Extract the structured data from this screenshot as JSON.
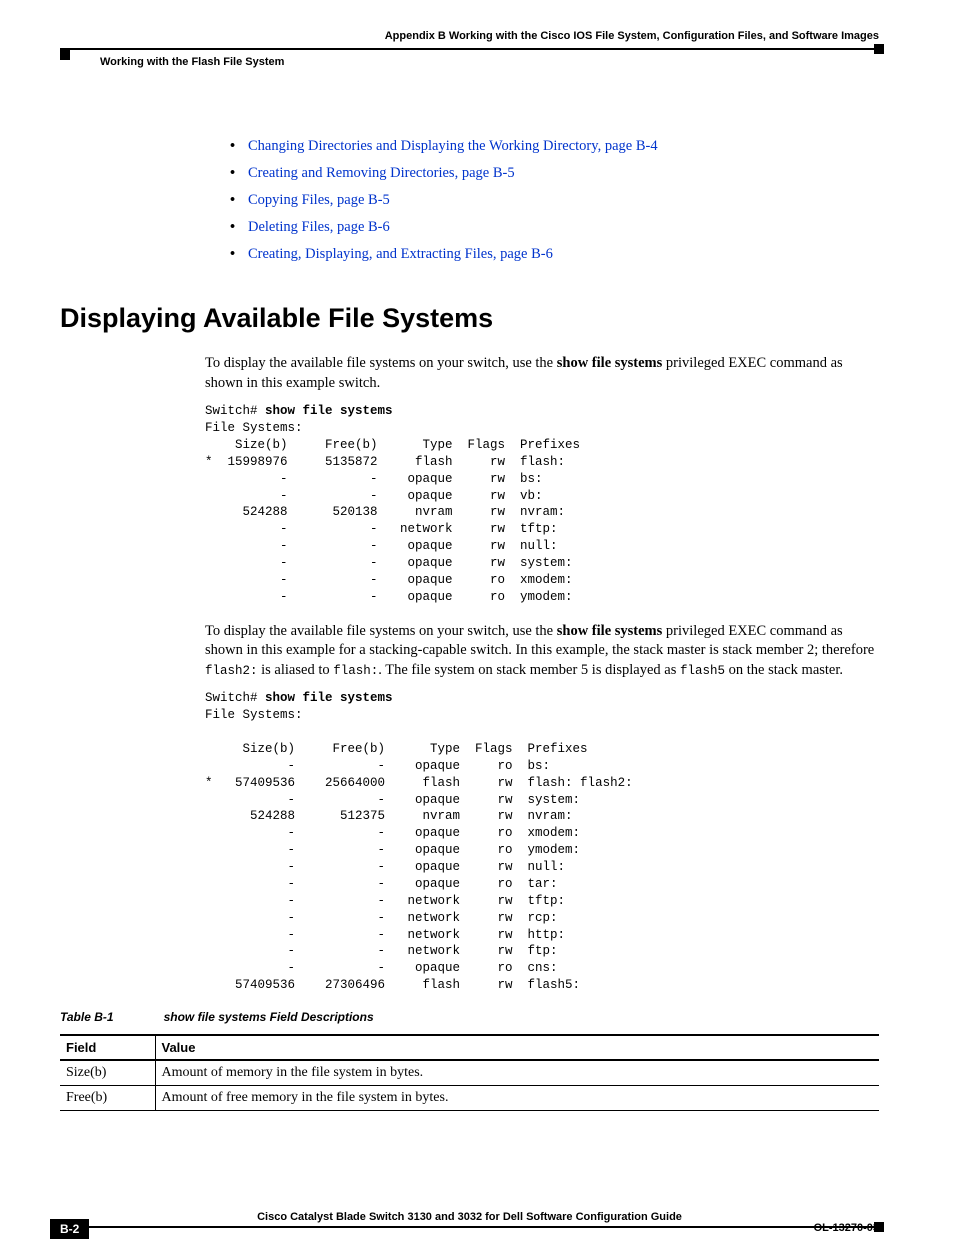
{
  "header": {
    "appendix": "Appendix B      Working with the Cisco IOS File System, Configuration Files, and Software Images",
    "section": "Working with the Flash File System"
  },
  "links": {
    "l1": "Changing Directories and Displaying the Working Directory, page B-4",
    "l2": "Creating and Removing Directories, page B-5",
    "l3": "Copying Files, page B-5",
    "l4": "Deleting Files, page B-6",
    "l5": "Creating, Displaying, and Extracting Files, page B-6"
  },
  "heading": "Displaying Available File Systems",
  "para1_a": "To display the available file systems on your switch, use the ",
  "para1_b": "show file systems",
  "para1_c": " privileged EXEC command as shown in this example switch.",
  "code1_prefix": "Switch# ",
  "code1_cmd": "show file systems",
  "code1_body": "File Systems:\n    Size(b)     Free(b)      Type  Flags  Prefixes\n*  15998976     5135872     flash     rw  flash:\n          -           -    opaque     rw  bs:\n          -           -    opaque     rw  vb:\n     524288      520138     nvram     rw  nvram:\n          -           -   network     rw  tftp:\n          -           -    opaque     rw  null:\n          -           -    opaque     rw  system:\n          -           -    opaque     ro  xmodem:\n          -           -    opaque     ro  ymodem:",
  "para2_a": "To display the available file systems on your switch, use the ",
  "para2_b": "show file systems",
  "para2_c": " privileged EXEC command as shown in this example for a stacking-capable switch. In this example, the stack master is stack member 2; therefore ",
  "para2_d": "flash2:",
  "para2_e": " is aliased to ",
  "para2_f": "flash:",
  "para2_g": ". The file system on stack member 5 is displayed as ",
  "para2_h": "flash5",
  "para2_i": " on the stack master.",
  "code2_prefix": "Switch# ",
  "code2_cmd": "show file systems",
  "code2_body": "File Systems:\n\n     Size(b)     Free(b)      Type  Flags  Prefixes\n           -           -    opaque     ro  bs:\n*   57409536    25664000     flash     rw  flash: flash2:\n           -           -    opaque     rw  system:\n      524288      512375     nvram     rw  nvram:\n           -           -    opaque     ro  xmodem:\n           -           -    opaque     ro  ymodem:\n           -           -    opaque     rw  null:\n           -           -    opaque     ro  tar:\n           -           -   network     rw  tftp:\n           -           -   network     rw  rcp:\n           -           -   network     rw  http:\n           -           -   network     rw  ftp:\n           -           -    opaque     ro  cns:\n    57409536    27306496     flash     rw  flash5:",
  "table": {
    "id": "Table B-1",
    "title": "show file systems Field Descriptions",
    "th_field": "Field",
    "th_value": "Value",
    "rows": [
      {
        "field": "Size(b)",
        "value": "Amount of memory in the file system in bytes."
      },
      {
        "field": "Free(b)",
        "value": "Amount of free memory in the file system in bytes."
      }
    ]
  },
  "footer": {
    "title": "Cisco Catalyst Blade Switch 3130 and 3032 for Dell Software Configuration Guide",
    "page": "B-2",
    "ol": "OL-13270-03"
  }
}
